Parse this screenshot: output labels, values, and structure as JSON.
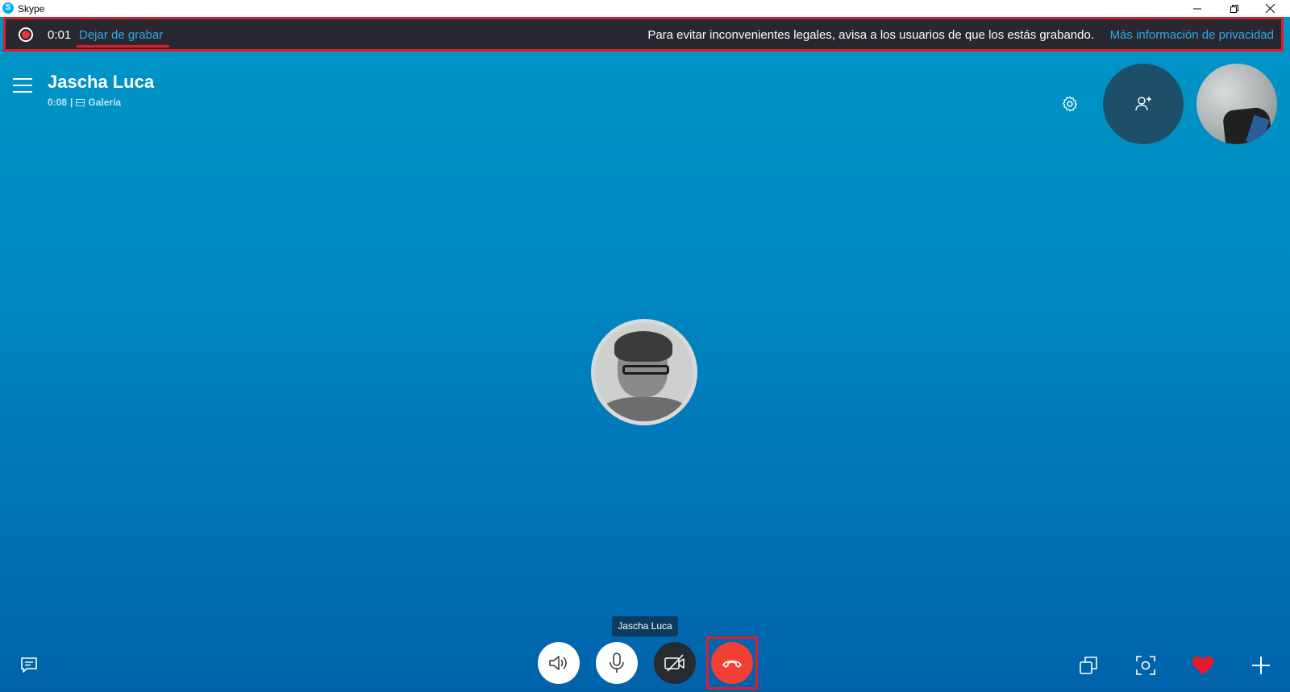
{
  "window": {
    "title": "Skype",
    "app_icon_letter": "S",
    "controls": [
      "minimize-icon",
      "restore-icon",
      "close-icon"
    ]
  },
  "recording_bar": {
    "time": "0:01",
    "stop_label": "Dejar de grabar",
    "warning": "Para evitar inconvenientes legales, avisa a los usuarios de que los estás grabando.",
    "privacy_link": "Más información de privacidad"
  },
  "call": {
    "contact_name": "Jascha Luca",
    "duration": "0:08",
    "separator": "|",
    "view_mode": "Galería",
    "tooltip": "Jascha Luca"
  },
  "colors": {
    "background_top": "#0097c7",
    "background_bottom": "#0062ab",
    "recording_bar": "#272830",
    "link": "#36a8e8",
    "highlight": "#e01e2b",
    "hangup": "#f03f33",
    "heart": "#e8192c"
  },
  "icons": {
    "menu": "menu-icon",
    "settings": "gear-icon",
    "add_people": "add-person-icon",
    "chat": "chat-icon",
    "speaker": "speaker-icon",
    "microphone": "microphone-icon",
    "video_off": "video-off-icon",
    "hangup": "phone-hangup-icon",
    "switch_view": "switch-view-icon",
    "snapshot": "camera-snapshot-icon",
    "reaction": "heart-icon",
    "more": "plus-icon"
  }
}
